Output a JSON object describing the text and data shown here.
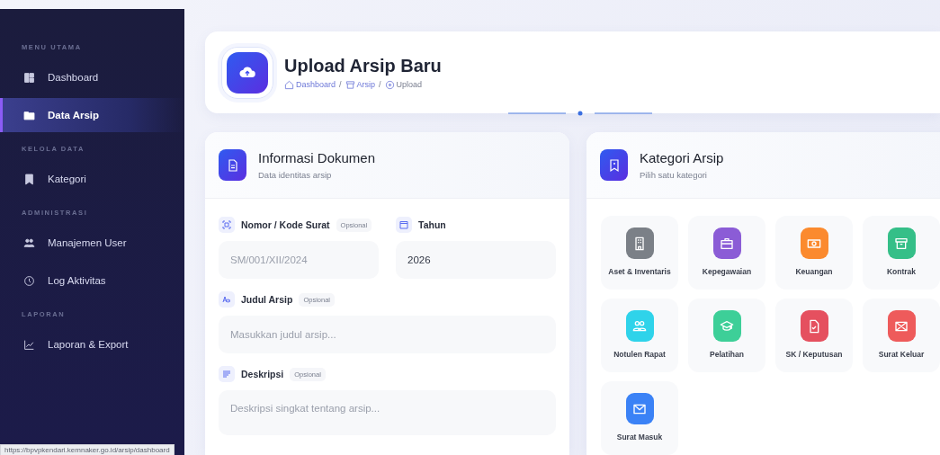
{
  "sidebar": {
    "sections": [
      {
        "label": "MENU UTAMA",
        "items": [
          {
            "label": "Dashboard",
            "selected": false
          },
          {
            "label": "Data Arsip",
            "selected": true
          }
        ]
      },
      {
        "label": "KELOLA DATA",
        "items": [
          {
            "label": "Kategori",
            "selected": false
          }
        ]
      },
      {
        "label": "ADMINISTRASI",
        "items": [
          {
            "label": "Manajemen User",
            "selected": false
          },
          {
            "label": "Log Aktivitas",
            "selected": false
          }
        ]
      },
      {
        "label": "LAPORAN",
        "items": [
          {
            "label": "Laporan & Export",
            "selected": false
          }
        ]
      }
    ]
  },
  "header": {
    "title": "Upload Arsip Baru",
    "breadcrumb": [
      {
        "label": "Dashboard"
      },
      {
        "label": "Arsip"
      },
      {
        "label": "Upload"
      }
    ],
    "separators": [
      "/",
      "/"
    ]
  },
  "info_card": {
    "title": "Informasi Dokumen",
    "subtitle": "Data identitas arsip",
    "fields": [
      {
        "label": "Nomor / Kode Surat",
        "badge": "Opsional",
        "placeholder": "SM/001/XII/2024",
        "kind": "input"
      },
      {
        "label": "Tahun",
        "value": "2026",
        "kind": "input"
      },
      {
        "label": "Judul Arsip",
        "badge": "Opsional",
        "placeholder": "Masukkan judul arsip...",
        "kind": "input"
      },
      {
        "label": "Deskripsi",
        "badge": "Opsional",
        "placeholder": "Deskripsi singkat tentang arsip...",
        "kind": "textarea"
      }
    ]
  },
  "category_card": {
    "title": "Kategori Arsip",
    "subtitle": "Pilih satu kategori",
    "categories": [
      {
        "label": "Aset & Inventaris",
        "color": "#7b8087"
      },
      {
        "label": "Kepegawaian",
        "color": "#8b5cd6"
      },
      {
        "label": "Keuangan",
        "color": "#fb8a2e"
      },
      {
        "label": "Kontrak",
        "color": "#35bf88"
      },
      {
        "label": "Notulen Rapat",
        "color": "#2fd3ea"
      },
      {
        "label": "Pelatihan",
        "color": "#3dcf98"
      },
      {
        "label": "SK / Keputusan",
        "color": "#e5505f"
      },
      {
        "label": "Surat Keluar",
        "color": "#ee5b5b"
      },
      {
        "label": "Surat Masuk",
        "color": "#3b82f6"
      }
    ]
  },
  "status_bar": {
    "url": "https://bpvpkendari.kemnaker.go.id/arsip/dashboard"
  }
}
